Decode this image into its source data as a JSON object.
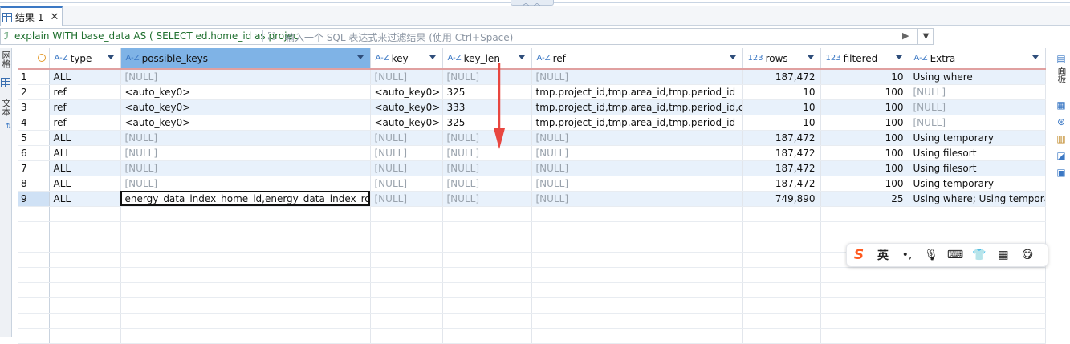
{
  "tab": {
    "title": "结果 1",
    "close": "✕"
  },
  "filter": {
    "sql": "explain WITH base_data AS ( SELECT ed.home_id as projec",
    "placeholder": "输入一个 SQL 表达式来过滤结果 (使用 Ctrl+Space)"
  },
  "left_strip": {
    "label_top": "网格",
    "label_bottom": "文本"
  },
  "right_strip": {
    "label": "面板"
  },
  "columns": [
    {
      "name": "type",
      "kind": "AZ"
    },
    {
      "name": "possible_keys",
      "kind": "AZ"
    },
    {
      "name": "key",
      "kind": "AZ"
    },
    {
      "name": "key_len",
      "kind": "AZ"
    },
    {
      "name": "ref",
      "kind": "AZ"
    },
    {
      "name": "rows",
      "kind": "123"
    },
    {
      "name": "filtered",
      "kind": "123"
    },
    {
      "name": "Extra",
      "kind": "AZ"
    }
  ],
  "rows": [
    {
      "n": "1",
      "type": "ALL",
      "possible_keys": "[NULL]",
      "key": "[NULL]",
      "key_len": "[NULL]",
      "ref": "[NULL]",
      "rows": "187,472",
      "filtered": "10",
      "extra": "Using where"
    },
    {
      "n": "2",
      "type": "ref",
      "possible_keys": "<auto_key0>",
      "key": "<auto_key0>",
      "key_len": "325",
      "ref": "tmp.project_id,tmp.area_id,tmp.period_id",
      "rows": "10",
      "filtered": "100",
      "extra": "[NULL]"
    },
    {
      "n": "3",
      "type": "ref",
      "possible_keys": "<auto_key0>",
      "key": "<auto_key0>",
      "key_len": "333",
      "ref": "tmp.project_id,tmp.area_id,tmp.period_id,const",
      "rows": "10",
      "filtered": "100",
      "extra": "[NULL]"
    },
    {
      "n": "4",
      "type": "ref",
      "possible_keys": "<auto_key0>",
      "key": "<auto_key0>",
      "key_len": "325",
      "ref": "tmp.project_id,tmp.area_id,tmp.period_id",
      "rows": "10",
      "filtered": "100",
      "extra": "[NULL]"
    },
    {
      "n": "5",
      "type": "ALL",
      "possible_keys": "[NULL]",
      "key": "[NULL]",
      "key_len": "[NULL]",
      "ref": "[NULL]",
      "rows": "187,472",
      "filtered": "100",
      "extra": "Using temporary"
    },
    {
      "n": "6",
      "type": "ALL",
      "possible_keys": "[NULL]",
      "key": "[NULL]",
      "key_len": "[NULL]",
      "ref": "[NULL]",
      "rows": "187,472",
      "filtered": "100",
      "extra": "Using filesort"
    },
    {
      "n": "7",
      "type": "ALL",
      "possible_keys": "[NULL]",
      "key": "[NULL]",
      "key_len": "[NULL]",
      "ref": "[NULL]",
      "rows": "187,472",
      "filtered": "100",
      "extra": "Using filesort"
    },
    {
      "n": "8",
      "type": "ALL",
      "possible_keys": "[NULL]",
      "key": "[NULL]",
      "key_len": "[NULL]",
      "ref": "[NULL]",
      "rows": "187,472",
      "filtered": "100",
      "extra": "Using temporary"
    },
    {
      "n": "9",
      "type": "ALL",
      "possible_keys": "energy_data_index_home_id,energy_data_index_room_id",
      "key": "[NULL]",
      "key_len": "[NULL]",
      "ref": "[NULL]",
      "rows": "749,890",
      "filtered": "25",
      "extra": "Using where; Using temporary"
    }
  ],
  "ime": {
    "lang": "英"
  },
  "colors": {
    "selected_header": "#7fb3e6",
    "alt_row": "#e8f1fb",
    "null_text": "#9aa3ad",
    "arrow": "#e8463f"
  }
}
